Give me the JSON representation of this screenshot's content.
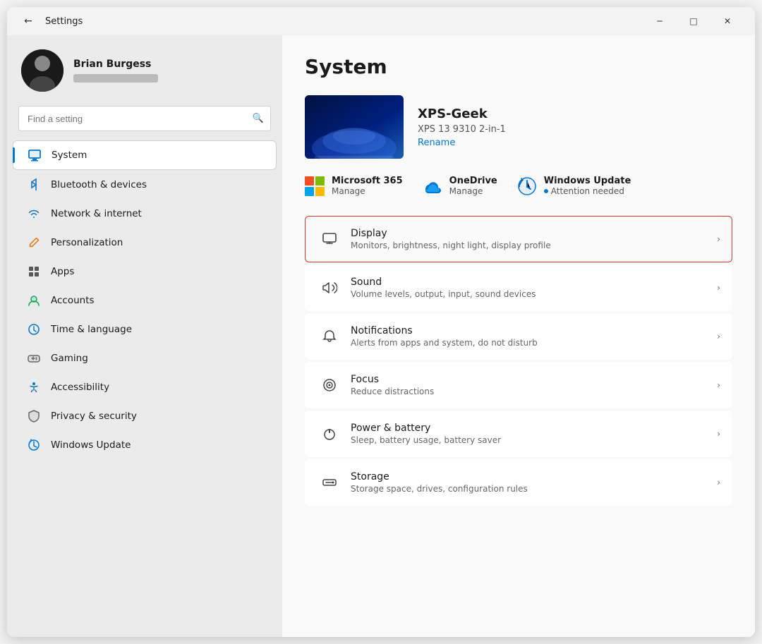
{
  "window": {
    "title": "Settings",
    "back_label": "←",
    "controls": {
      "minimize": "─",
      "maximize": "□",
      "close": "✕"
    }
  },
  "sidebar": {
    "user": {
      "name": "Brian Burgess",
      "email_placeholder": "•••••••••••••"
    },
    "search": {
      "placeholder": "Find a setting"
    },
    "nav_items": [
      {
        "id": "system",
        "label": "System",
        "icon": "🖥",
        "active": true
      },
      {
        "id": "bluetooth",
        "label": "Bluetooth & devices",
        "icon": "🔵"
      },
      {
        "id": "network",
        "label": "Network & internet",
        "icon": "📶"
      },
      {
        "id": "personalization",
        "label": "Personalization",
        "icon": "✏️"
      },
      {
        "id": "apps",
        "label": "Apps",
        "icon": "📦"
      },
      {
        "id": "accounts",
        "label": "Accounts",
        "icon": "👤"
      },
      {
        "id": "time",
        "label": "Time & language",
        "icon": "🕐"
      },
      {
        "id": "gaming",
        "label": "Gaming",
        "icon": "🎮"
      },
      {
        "id": "accessibility",
        "label": "Accessibility",
        "icon": "♿"
      },
      {
        "id": "privacy",
        "label": "Privacy & security",
        "icon": "🛡"
      },
      {
        "id": "windows_update",
        "label": "Windows Update",
        "icon": "🔄"
      }
    ]
  },
  "main": {
    "page_title": "System",
    "device": {
      "name": "XPS-Geek",
      "model": "XPS 13 9310 2-in-1",
      "rename_label": "Rename"
    },
    "services": [
      {
        "id": "microsoft365",
        "label": "Microsoft 365",
        "action": "Manage"
      },
      {
        "id": "onedrive",
        "label": "OneDrive",
        "action": "Manage"
      },
      {
        "id": "windows_update",
        "label": "Windows Update",
        "status": "Attention needed"
      }
    ],
    "settings_rows": [
      {
        "id": "display",
        "title": "Display",
        "subtitle": "Monitors, brightness, night light, display profile",
        "highlighted": true
      },
      {
        "id": "sound",
        "title": "Sound",
        "subtitle": "Volume levels, output, input, sound devices",
        "highlighted": false
      },
      {
        "id": "notifications",
        "title": "Notifications",
        "subtitle": "Alerts from apps and system, do not disturb",
        "highlighted": false
      },
      {
        "id": "focus",
        "title": "Focus",
        "subtitle": "Reduce distractions",
        "highlighted": false
      },
      {
        "id": "power",
        "title": "Power & battery",
        "subtitle": "Sleep, battery usage, battery saver",
        "highlighted": false
      },
      {
        "id": "storage",
        "title": "Storage",
        "subtitle": "Storage space, drives, configuration rules",
        "highlighted": false
      }
    ]
  }
}
